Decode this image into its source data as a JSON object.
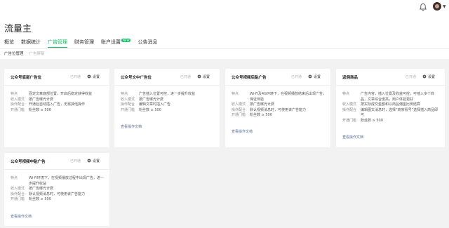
{
  "header": {
    "title": "流量主",
    "tabs": [
      {
        "label": "概览"
      },
      {
        "label": "数据统计"
      },
      {
        "label": "广告管理"
      },
      {
        "label": "财务管理"
      },
      {
        "label": "账户设置",
        "badge": "NEW"
      },
      {
        "label": "公告消息"
      }
    ],
    "subtabs": [
      {
        "label": "广告位管理"
      },
      {
        "label": "广告屏蔽"
      }
    ]
  },
  "cards": [
    {
      "title": "公众号底部广告位",
      "status": "已开通",
      "settings": "设置",
      "rows": [
        {
          "k": "特点",
          "v": "固定文章底部位置，开启后稳定获得收益"
        },
        {
          "k": "收入模式",
          "v": "按广告曝光计费"
        },
        {
          "k": "操作配合",
          "v": "开通后自动插入广告，无需其他操作"
        },
        {
          "k": "开通门槛",
          "v": "粉丝数 ≥ 500"
        }
      ]
    },
    {
      "title": "公众号文中广告位",
      "status": "已开通",
      "settings": "设置",
      "rows": [
        {
          "k": "特点",
          "v": "广告插入位置可控，进一步提升收益"
        },
        {
          "k": "收入模式",
          "v": "按广告曝光计费"
        },
        {
          "k": "操作配合",
          "v": "编辑文章时插入广告"
        },
        {
          "k": "开通门槛",
          "v": "粉丝数 ≥ 500"
        }
      ],
      "link": "查看操作文档"
    },
    {
      "title": "公众号视频后贴广告",
      "status": "已开通",
      "settings": "设置",
      "rows": [
        {
          "k": "特点",
          "v": "Wi-Fi及4G环境下，在视频播放结束后出现广告，保证体验"
        },
        {
          "k": "收入模式",
          "v": "按广告曝光计费"
        },
        {
          "k": "操作配合",
          "v": "默认视频消息时，可使用该广告能力"
        },
        {
          "k": "开通门槛",
          "v": "粉丝数 ≥ 500"
        }
      ],
      "link": "查看操作文档"
    },
    {
      "title": "返佣商品",
      "status": "已开通",
      "settings": "设置",
      "rows": [
        {
          "k": "特点",
          "v": "广告内容，插入位置及收益可控，可插入多个商品，文章综合度高，用户体验更好"
        },
        {
          "k": "收入模式",
          "v": "按实际成交金额和以商品佣金比例结算"
        },
        {
          "k": "操作配合",
          "v": "编辑图文消息时，选择“商家看号”选择插入商品即可"
        },
        {
          "k": "开通门槛",
          "v": "粉丝数 ≥ 500"
        }
      ],
      "link": "查看操作文档"
    },
    {
      "title": "公众号视频中贴广告",
      "status": "已开通",
      "settings": "设置",
      "rows": [
        {
          "k": "特点",
          "v": "Wi-Fi环境下，在视频播放过程中出现广告，进一步提升收益"
        },
        {
          "k": "收入模式",
          "v": "按广告曝光计费"
        },
        {
          "k": "操作配合",
          "v": "默认视频消息时，可使用该广告能力"
        },
        {
          "k": "开通门槛",
          "v": "粉丝数 ≥ 500"
        }
      ],
      "link": "查看操作文档"
    }
  ],
  "colors": {
    "accent": "#07c160",
    "link": "#576b95",
    "muted": "#b2b2b2"
  },
  "icons": {
    "bell": "bell-icon",
    "gear": "gear-icon",
    "avatar": "avatar",
    "caret": "chevron-down-icon"
  }
}
